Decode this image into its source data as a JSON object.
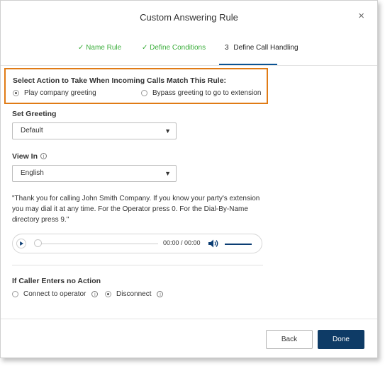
{
  "dialog": {
    "title": "Custom Answering Rule",
    "close": "×"
  },
  "steps": [
    {
      "check": "✓",
      "label": "Name Rule"
    },
    {
      "check": "✓",
      "label": "Define Conditions"
    },
    {
      "number": "3",
      "label": "Define Call Handling"
    }
  ],
  "action": {
    "heading": "Select Action to Take When Incoming Calls Match This Rule:",
    "options": [
      {
        "label": "Play company greeting",
        "selected": true
      },
      {
        "label": "Bypass greeting to go to extension",
        "selected": false
      }
    ]
  },
  "greeting": {
    "label": "Set Greeting",
    "value": "Default"
  },
  "view_in": {
    "label": "View In",
    "value": "English",
    "info": "i"
  },
  "greeting_text": "\"Thank you for calling John Smith Company. If you know your party's extension you may dial it at any time. For the Operator press 0. For the Dial-By-Name directory press 9.\"",
  "player": {
    "time": "00:00 / 00:00",
    "progress": 0
  },
  "no_action": {
    "label": "If Caller Enters no Action",
    "options": [
      {
        "label": "Connect to operator",
        "selected": false,
        "info": "i"
      },
      {
        "label": "Disconnect",
        "selected": true,
        "info": "i"
      }
    ]
  },
  "footer": {
    "back": "Back",
    "done": "Done"
  },
  "colors": {
    "accent": "#0e3b66",
    "highlight": "#e07b15",
    "step_done": "#3cae3c"
  },
  "icons": [
    "close-icon",
    "check-icon",
    "chevron-down-icon",
    "info-icon",
    "play-icon",
    "volume-icon"
  ]
}
